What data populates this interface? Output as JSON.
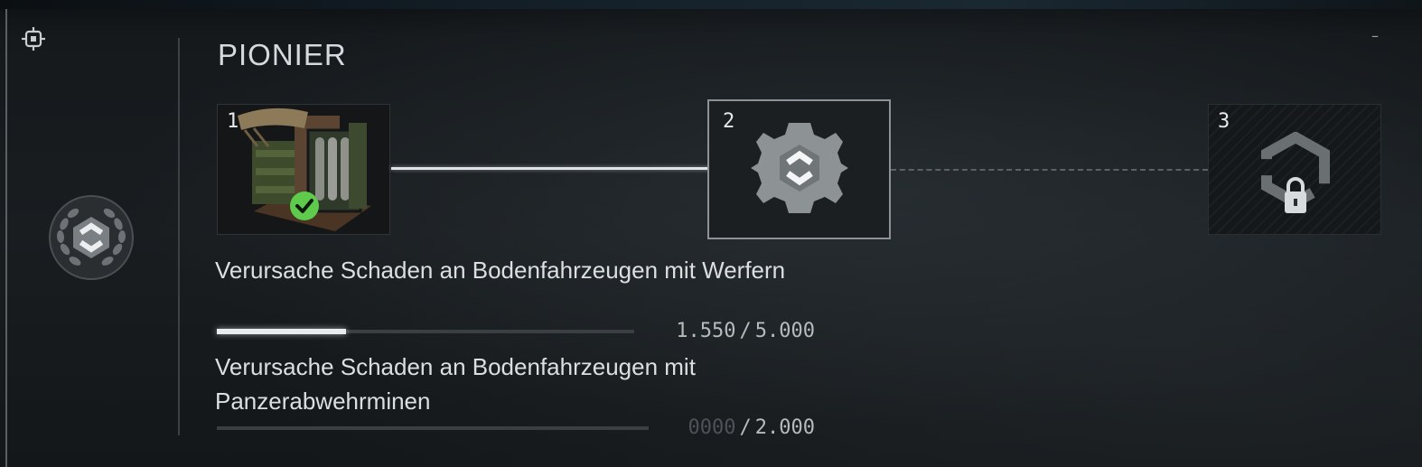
{
  "panel": {
    "title": "PIONIER",
    "collapse_symbol": "–",
    "icons": {
      "target": "crosshair-target-icon",
      "emblem": "laurel-emblem-icon",
      "tier_2": "gear-medal-icon",
      "tier_3": "locked-medal-icon",
      "completed": "check-badge-icon"
    },
    "colors": {
      "accent_white": "#e8ecee",
      "complete_green": "#5ecb4c",
      "track": "#3a3f42"
    }
  },
  "tiers": [
    {
      "number": "1",
      "state": "completed"
    },
    {
      "number": "2",
      "state": "active"
    },
    {
      "number": "3",
      "state": "locked"
    }
  ],
  "tasks": [
    {
      "text": "Verursache Schaden an Bodenfahrzeugen mit Werfern",
      "current": "1.550",
      "separator": "/",
      "target": "5.000",
      "progress": 0.31
    },
    {
      "text": "Verursache Schaden an Bodenfahrzeugen mit Panzerabwehrminen",
      "current": "0000",
      "separator": "/",
      "target": "2.000",
      "progress": 0
    }
  ]
}
